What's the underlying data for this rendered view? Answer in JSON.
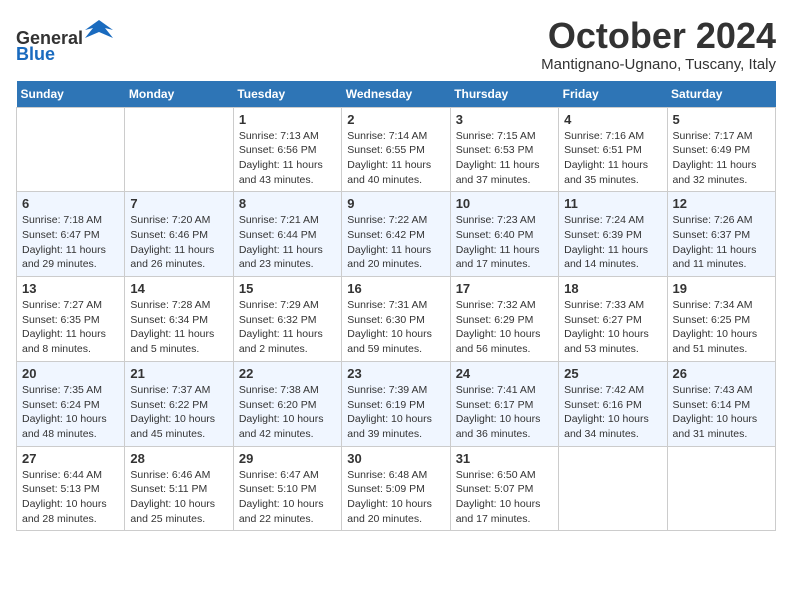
{
  "header": {
    "logo_line1": "General",
    "logo_line2": "Blue",
    "month_title": "October 2024",
    "location": "Mantignano-Ugnano, Tuscany, Italy"
  },
  "weekdays": [
    "Sunday",
    "Monday",
    "Tuesday",
    "Wednesday",
    "Thursday",
    "Friday",
    "Saturday"
  ],
  "weeks": [
    [
      {
        "day": "",
        "info": ""
      },
      {
        "day": "",
        "info": ""
      },
      {
        "day": "1",
        "info": "Sunrise: 7:13 AM\nSunset: 6:56 PM\nDaylight: 11 hours and 43 minutes."
      },
      {
        "day": "2",
        "info": "Sunrise: 7:14 AM\nSunset: 6:55 PM\nDaylight: 11 hours and 40 minutes."
      },
      {
        "day": "3",
        "info": "Sunrise: 7:15 AM\nSunset: 6:53 PM\nDaylight: 11 hours and 37 minutes."
      },
      {
        "day": "4",
        "info": "Sunrise: 7:16 AM\nSunset: 6:51 PM\nDaylight: 11 hours and 35 minutes."
      },
      {
        "day": "5",
        "info": "Sunrise: 7:17 AM\nSunset: 6:49 PM\nDaylight: 11 hours and 32 minutes."
      }
    ],
    [
      {
        "day": "6",
        "info": "Sunrise: 7:18 AM\nSunset: 6:47 PM\nDaylight: 11 hours and 29 minutes."
      },
      {
        "day": "7",
        "info": "Sunrise: 7:20 AM\nSunset: 6:46 PM\nDaylight: 11 hours and 26 minutes."
      },
      {
        "day": "8",
        "info": "Sunrise: 7:21 AM\nSunset: 6:44 PM\nDaylight: 11 hours and 23 minutes."
      },
      {
        "day": "9",
        "info": "Sunrise: 7:22 AM\nSunset: 6:42 PM\nDaylight: 11 hours and 20 minutes."
      },
      {
        "day": "10",
        "info": "Sunrise: 7:23 AM\nSunset: 6:40 PM\nDaylight: 11 hours and 17 minutes."
      },
      {
        "day": "11",
        "info": "Sunrise: 7:24 AM\nSunset: 6:39 PM\nDaylight: 11 hours and 14 minutes."
      },
      {
        "day": "12",
        "info": "Sunrise: 7:26 AM\nSunset: 6:37 PM\nDaylight: 11 hours and 11 minutes."
      }
    ],
    [
      {
        "day": "13",
        "info": "Sunrise: 7:27 AM\nSunset: 6:35 PM\nDaylight: 11 hours and 8 minutes."
      },
      {
        "day": "14",
        "info": "Sunrise: 7:28 AM\nSunset: 6:34 PM\nDaylight: 11 hours and 5 minutes."
      },
      {
        "day": "15",
        "info": "Sunrise: 7:29 AM\nSunset: 6:32 PM\nDaylight: 11 hours and 2 minutes."
      },
      {
        "day": "16",
        "info": "Sunrise: 7:31 AM\nSunset: 6:30 PM\nDaylight: 10 hours and 59 minutes."
      },
      {
        "day": "17",
        "info": "Sunrise: 7:32 AM\nSunset: 6:29 PM\nDaylight: 10 hours and 56 minutes."
      },
      {
        "day": "18",
        "info": "Sunrise: 7:33 AM\nSunset: 6:27 PM\nDaylight: 10 hours and 53 minutes."
      },
      {
        "day": "19",
        "info": "Sunrise: 7:34 AM\nSunset: 6:25 PM\nDaylight: 10 hours and 51 minutes."
      }
    ],
    [
      {
        "day": "20",
        "info": "Sunrise: 7:35 AM\nSunset: 6:24 PM\nDaylight: 10 hours and 48 minutes."
      },
      {
        "day": "21",
        "info": "Sunrise: 7:37 AM\nSunset: 6:22 PM\nDaylight: 10 hours and 45 minutes."
      },
      {
        "day": "22",
        "info": "Sunrise: 7:38 AM\nSunset: 6:20 PM\nDaylight: 10 hours and 42 minutes."
      },
      {
        "day": "23",
        "info": "Sunrise: 7:39 AM\nSunset: 6:19 PM\nDaylight: 10 hours and 39 minutes."
      },
      {
        "day": "24",
        "info": "Sunrise: 7:41 AM\nSunset: 6:17 PM\nDaylight: 10 hours and 36 minutes."
      },
      {
        "day": "25",
        "info": "Sunrise: 7:42 AM\nSunset: 6:16 PM\nDaylight: 10 hours and 34 minutes."
      },
      {
        "day": "26",
        "info": "Sunrise: 7:43 AM\nSunset: 6:14 PM\nDaylight: 10 hours and 31 minutes."
      }
    ],
    [
      {
        "day": "27",
        "info": "Sunrise: 6:44 AM\nSunset: 5:13 PM\nDaylight: 10 hours and 28 minutes."
      },
      {
        "day": "28",
        "info": "Sunrise: 6:46 AM\nSunset: 5:11 PM\nDaylight: 10 hours and 25 minutes."
      },
      {
        "day": "29",
        "info": "Sunrise: 6:47 AM\nSunset: 5:10 PM\nDaylight: 10 hours and 22 minutes."
      },
      {
        "day": "30",
        "info": "Sunrise: 6:48 AM\nSunset: 5:09 PM\nDaylight: 10 hours and 20 minutes."
      },
      {
        "day": "31",
        "info": "Sunrise: 6:50 AM\nSunset: 5:07 PM\nDaylight: 10 hours and 17 minutes."
      },
      {
        "day": "",
        "info": ""
      },
      {
        "day": "",
        "info": ""
      }
    ]
  ]
}
